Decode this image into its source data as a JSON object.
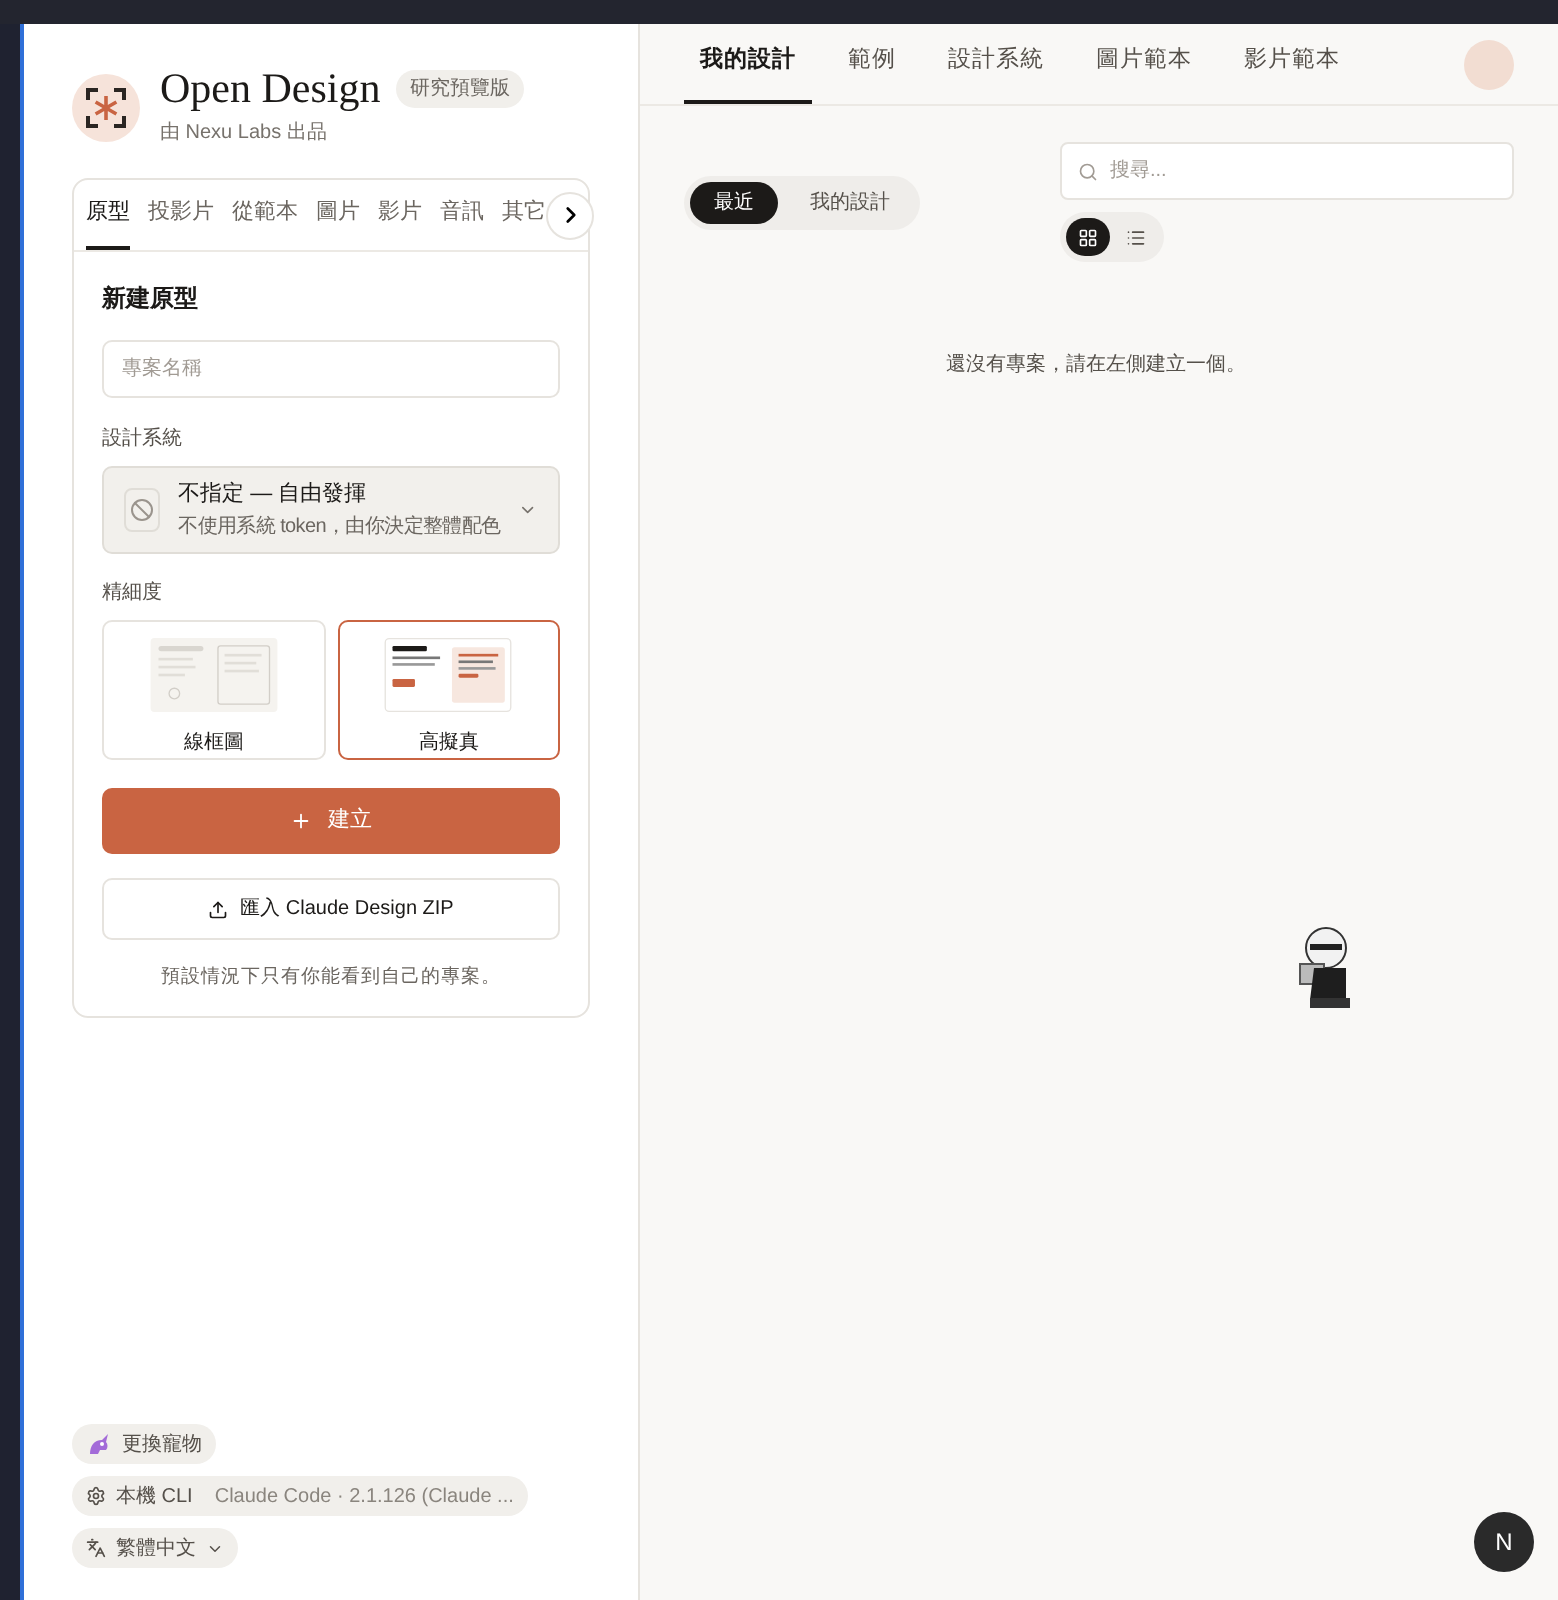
{
  "brand": {
    "title": "Open Design",
    "badge": "研究預覽版",
    "subtitle": "由 Nexu Labs 出品"
  },
  "type_tabs": [
    {
      "label": "原型",
      "selected": true
    },
    {
      "label": "投影片",
      "selected": false
    },
    {
      "label": "從範本",
      "selected": false
    },
    {
      "label": "圖片",
      "selected": false
    },
    {
      "label": "影片",
      "selected": false
    },
    {
      "label": "音訊",
      "selected": false
    },
    {
      "label": "其它",
      "selected": false
    }
  ],
  "form": {
    "heading": "新建原型",
    "name_field": {
      "placeholder": "專案名稱"
    },
    "design_system": {
      "label": "設計系統",
      "title": "不指定 — 自由發揮",
      "description": "不使用系統 token，由你決定整體配色"
    },
    "fidelity": {
      "label": "精細度",
      "options": [
        {
          "label": "線框圖",
          "kind": "wireframe",
          "selected": false
        },
        {
          "label": "高擬真",
          "kind": "hifi",
          "selected": true
        }
      ]
    },
    "create_button": "建立",
    "import_button": "匯入 Claude Design ZIP",
    "note": "預設情況下只有你能看到自己的專案。"
  },
  "footer": {
    "pet_button": "更換寵物",
    "agent": {
      "label": "本機 CLI",
      "detail": "Claude Code · 2.1.126 (Claude ..."
    },
    "language": "繁體中文"
  },
  "nav_tabs": [
    {
      "label": "我的設計",
      "selected": true
    },
    {
      "label": "範例",
      "selected": false
    },
    {
      "label": "設計系統",
      "selected": false
    },
    {
      "label": "圖片範本",
      "selected": false
    },
    {
      "label": "影片範本",
      "selected": false
    }
  ],
  "filters": [
    {
      "label": "最近",
      "selected": true
    },
    {
      "label": "我的設計",
      "selected": false
    }
  ],
  "search": {
    "placeholder": "搜尋..."
  },
  "view_toggle": [
    {
      "kind": "grid",
      "selected": true
    },
    {
      "kind": "list",
      "selected": false
    }
  ],
  "empty_message": "還沒有專案，請在左側建立一個。",
  "fab": "N"
}
